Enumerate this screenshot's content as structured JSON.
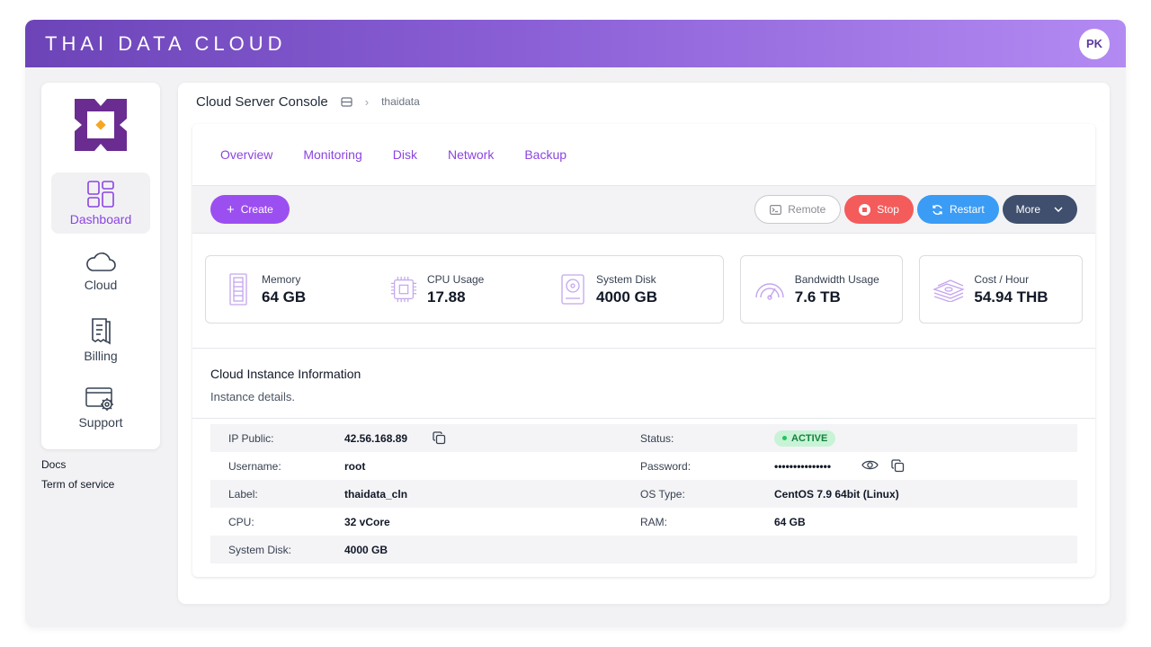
{
  "header": {
    "brand": "THAI DATA CLOUD",
    "avatar_initials": "PK"
  },
  "colors": {
    "accent": "#8b45e0",
    "stop": "#f45b5b",
    "restart": "#3b9cf5",
    "more": "#3f4f6d",
    "active_badge": "#c9f3d6"
  },
  "sidebar": {
    "items": [
      {
        "label": "Dashboard",
        "icon": "dashboard-icon",
        "active": true
      },
      {
        "label": "Cloud",
        "icon": "cloud-icon"
      },
      {
        "label": "Billing",
        "icon": "receipt-icon"
      },
      {
        "label": "Support",
        "icon": "support-gear-icon"
      }
    ],
    "links": [
      "Docs",
      "Term of service"
    ]
  },
  "breadcrumb": {
    "title": "Cloud Server Console",
    "current": "thaidata"
  },
  "tabs": [
    "Overview",
    "Monitoring",
    "Disk",
    "Network",
    "Backup"
  ],
  "toolbar": {
    "create": "Create",
    "remote": "Remote",
    "stop": "Stop",
    "restart": "Restart",
    "more": "More"
  },
  "stats": [
    {
      "label": "Memory",
      "value": "64 GB",
      "icon": "memory-icon"
    },
    {
      "label": "CPU Usage",
      "value": "17.88",
      "icon": "cpu-icon"
    },
    {
      "label": "System Disk",
      "value": "4000 GB",
      "icon": "disk-icon"
    },
    {
      "label": "Bandwidth Usage",
      "value": "7.6 TB",
      "icon": "gauge-icon"
    },
    {
      "label": "Cost / Hour",
      "value": "54.94 THB",
      "icon": "money-icon"
    }
  ],
  "info": {
    "title": "Cloud Instance Information",
    "subtitle": "Instance details.",
    "rows": [
      {
        "l1": "IP Public:",
        "v1": "42.56.168.89",
        "l2": "Status:",
        "v2": "ACTIVE"
      },
      {
        "l1": "Username:",
        "v1": "root",
        "l2": "Password:",
        "v2": "•••••••••••••••"
      },
      {
        "l1": "Label:",
        "v1": "thaidata_cln",
        "l2": "OS Type:",
        "v2": "CentOS 7.9 64bit (Linux)"
      },
      {
        "l1": "CPU:",
        "v1": "32 vCore",
        "l2": "RAM:",
        "v2": "64 GB"
      },
      {
        "l1": "System Disk:",
        "v1": "4000 GB",
        "l2": "",
        "v2": ""
      }
    ]
  }
}
